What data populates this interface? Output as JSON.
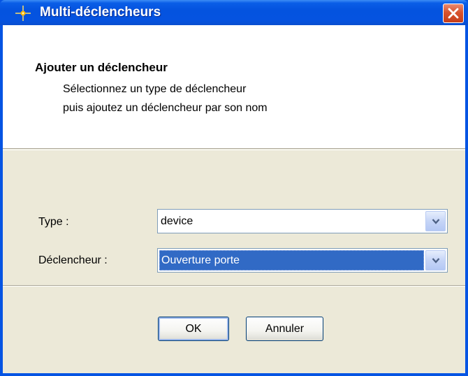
{
  "window": {
    "title": "Multi-déclencheurs"
  },
  "header": {
    "title": "Ajouter un déclencheur",
    "line1": "Sélectionnez un type de déclencheur",
    "line2": "puis ajoutez un déclencheur par son nom"
  },
  "form": {
    "type_label": "Type :",
    "type_value": "device",
    "trigger_label": "Déclencheur :",
    "trigger_value": "Ouverture porte"
  },
  "buttons": {
    "ok_label": "OK",
    "cancel_label": "Annuler"
  },
  "colors": {
    "titlebar": "#0553e0",
    "close_button": "#d8532e",
    "dialog_background": "#ece9d8",
    "selection": "#316ac5"
  },
  "icons": {
    "app": "sparkle-icon",
    "close": "close-icon",
    "dropdown": "chevron-down-icon"
  }
}
